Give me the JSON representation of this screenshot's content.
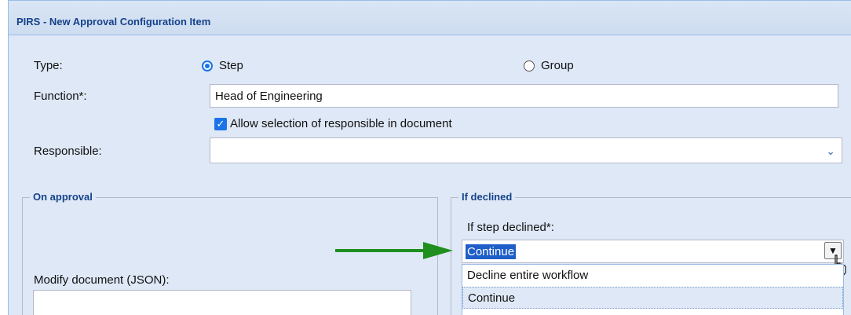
{
  "dialog": {
    "title": "PIRS - New Approval Configuration Item"
  },
  "form": {
    "type_label": "Type:",
    "type_options": [
      {
        "label": "Step",
        "selected": true
      },
      {
        "label": "Group",
        "selected": false
      }
    ],
    "function_label": "Function*:",
    "function_value": "Head of Engineering",
    "allow_selection_label": "Allow selection of responsible in document",
    "allow_selection_checked": true,
    "responsible_label": "Responsible:",
    "responsible_value": ""
  },
  "on_approval": {
    "legend": "On approval",
    "modify_doc_label": "Modify document (JSON):",
    "modify_doc_value": ""
  },
  "if_declined": {
    "legend": "If declined",
    "step_declined_label": "If step declined*:",
    "step_declined_value": "Continue",
    "options": [
      "Decline entire workflow",
      "Continue"
    ],
    "highlighted_option": "Continue"
  },
  "colors": {
    "panel_bg": "#dfe8f6",
    "title_text": "#15428b",
    "accent": "#1a73e8",
    "selection": "#1f5ec8",
    "annotation_arrow": "#1f8f1f"
  },
  "icons": [
    "radio-selected",
    "radio-unselected",
    "checkbox-checked",
    "chevron-down-icon",
    "hand-cursor-icon",
    "green-arrow"
  ]
}
